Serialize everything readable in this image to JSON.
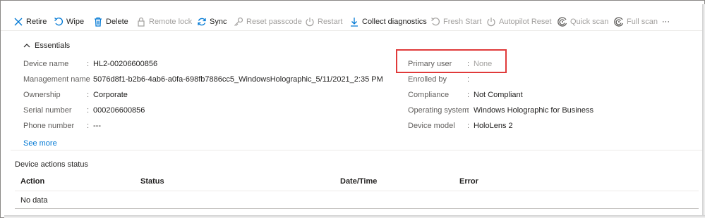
{
  "toolbar": {
    "items": [
      {
        "label": "Retire",
        "icon": "close-icon",
        "disabled": false
      },
      {
        "label": "Wipe",
        "icon": "undo-icon",
        "disabled": false
      },
      {
        "label": "Delete",
        "icon": "trash-icon",
        "disabled": false
      },
      {
        "label": "Remote lock",
        "icon": "lock-icon",
        "disabled": true
      },
      {
        "label": "Sync",
        "icon": "sync-icon",
        "disabled": false
      },
      {
        "label": "Reset passcode",
        "icon": "key-icon",
        "disabled": true
      },
      {
        "label": "Restart",
        "icon": "power-icon",
        "disabled": true
      },
      {
        "label": "Collect diagnostics",
        "icon": "download-icon",
        "disabled": false
      },
      {
        "label": "Fresh Start",
        "icon": "undo-icon",
        "disabled": true
      },
      {
        "label": "Autopilot Reset",
        "icon": "power-icon",
        "disabled": true
      },
      {
        "label": "Quick scan",
        "icon": "scan-icon",
        "disabled": true
      },
      {
        "label": "Full scan",
        "icon": "scan-icon",
        "disabled": true
      }
    ],
    "more_label": "···",
    "accent_color": "#0078d4",
    "disabled_color": "#a19f9d"
  },
  "essentials": {
    "title": "Essentials",
    "left": [
      {
        "label": "Device name",
        "value": "HL2-00206600856"
      },
      {
        "label": "Management name",
        "value": "5076d8f1-b2b6-4ab6-a0fa-698fb7886cc5_WindowsHolographic_5/11/2021_2:35 PM"
      },
      {
        "label": "Ownership",
        "value": "Corporate"
      },
      {
        "label": "Serial number",
        "value": "000206600856"
      },
      {
        "label": "Phone number",
        "value": "---"
      }
    ],
    "right": [
      {
        "label": "Primary user",
        "value": "None"
      },
      {
        "label": "Enrolled by",
        "value": ""
      },
      {
        "label": "Compliance",
        "value": "Not Compliant"
      },
      {
        "label": "Operating system",
        "value": "Windows Holographic for Business"
      },
      {
        "label": "Device model",
        "value": "HoloLens 2"
      }
    ],
    "see_more": "See more",
    "highlight_color": "#e03a3a"
  },
  "actions_status": {
    "title": "Device actions status",
    "columns": [
      "Action",
      "Status",
      "Date/Time",
      "Error"
    ],
    "empty_text": "No data"
  }
}
